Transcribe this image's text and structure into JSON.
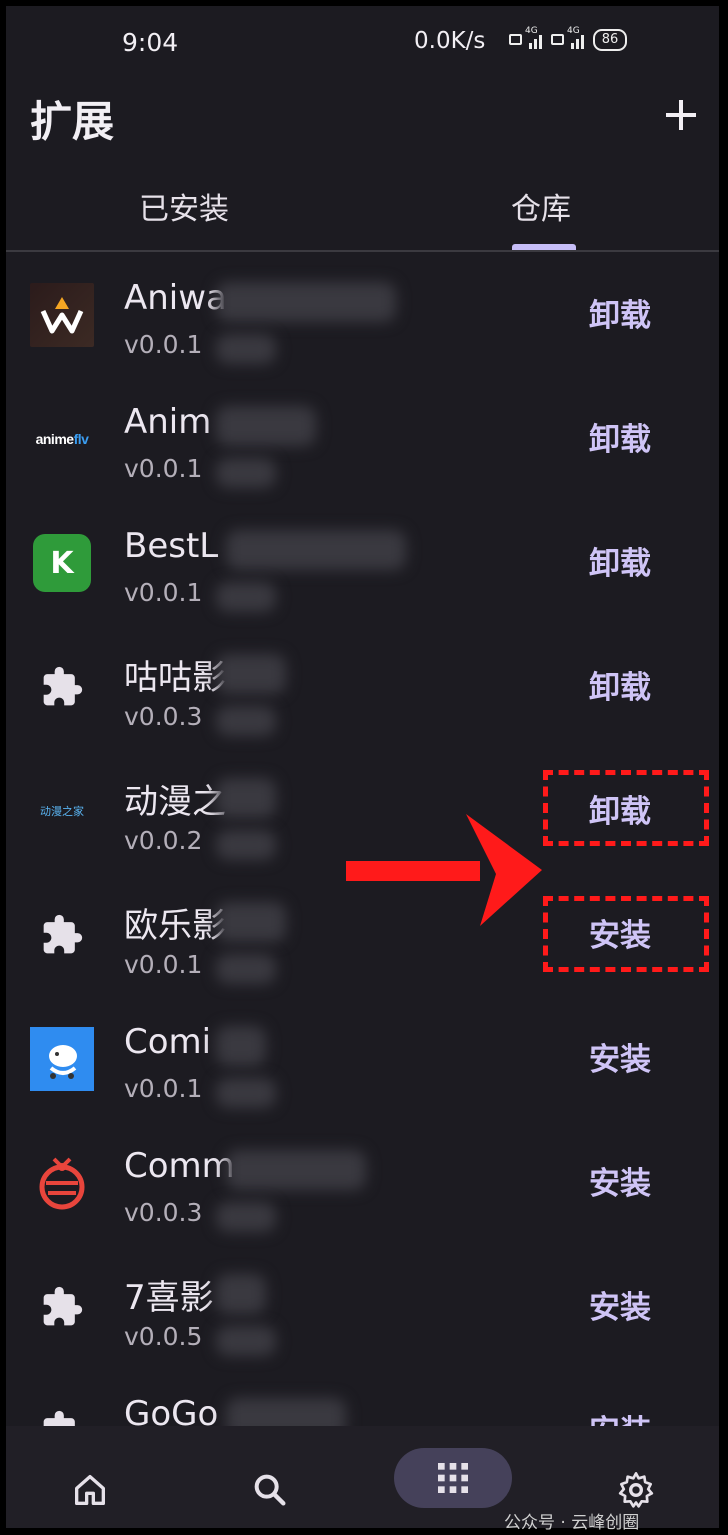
{
  "status_bar": {
    "time": "9:04",
    "network_speed": "0.0K/s",
    "battery": "86"
  },
  "header": {
    "title": "扩展",
    "add_button_icon": "plus-icon"
  },
  "tabs": [
    {
      "label": "已安装",
      "selected": false
    },
    {
      "label": "仓库",
      "selected": true
    }
  ],
  "extensions": [
    {
      "name": "Aniwa",
      "version": "v0.0.1",
      "action": "卸载",
      "icon": "aniwave-logo"
    },
    {
      "name": "Anim",
      "version": "v0.0.1",
      "action": "卸载",
      "icon": "animeflv-logo"
    },
    {
      "name": "BestL",
      "version": "v0.0.1",
      "action": "卸载",
      "icon": "best-logo"
    },
    {
      "name": "咕咕影",
      "version": "v0.0.3",
      "action": "卸载",
      "icon": "puzzle-icon"
    },
    {
      "name": "动漫之",
      "version": "v0.0.2",
      "action": "卸载",
      "icon": "dongman-logo"
    },
    {
      "name": "欧乐影",
      "version": "v0.0.1",
      "action": "安装",
      "icon": "puzzle-icon"
    },
    {
      "name": "Comi",
      "version": "v0.0.1",
      "action": "安装",
      "icon": "comi-logo"
    },
    {
      "name": "Comm",
      "version": "v0.0.3",
      "action": "安装",
      "icon": "comm-logo"
    },
    {
      "name": "7喜影",
      "version": "v0.0.5",
      "action": "安装",
      "icon": "puzzle-icon"
    },
    {
      "name": "GoGo",
      "version": "",
      "action": "安装",
      "icon": "puzzle-icon"
    }
  ],
  "logos": {
    "animeflv_a": "anime",
    "animeflv_b": "flv",
    "best_letter": "K",
    "dongman_text": "动漫之家"
  },
  "bottom_nav": [
    {
      "icon": "home-icon"
    },
    {
      "icon": "search-icon"
    },
    {
      "icon": "grid-icon",
      "selected": true
    },
    {
      "icon": "gear-icon"
    }
  ],
  "watermark": "公众号 · 云峰创圈",
  "colors": {
    "background": "#1c1b21",
    "accent": "#cfc4f6",
    "annotation": "#ff1a1a"
  }
}
